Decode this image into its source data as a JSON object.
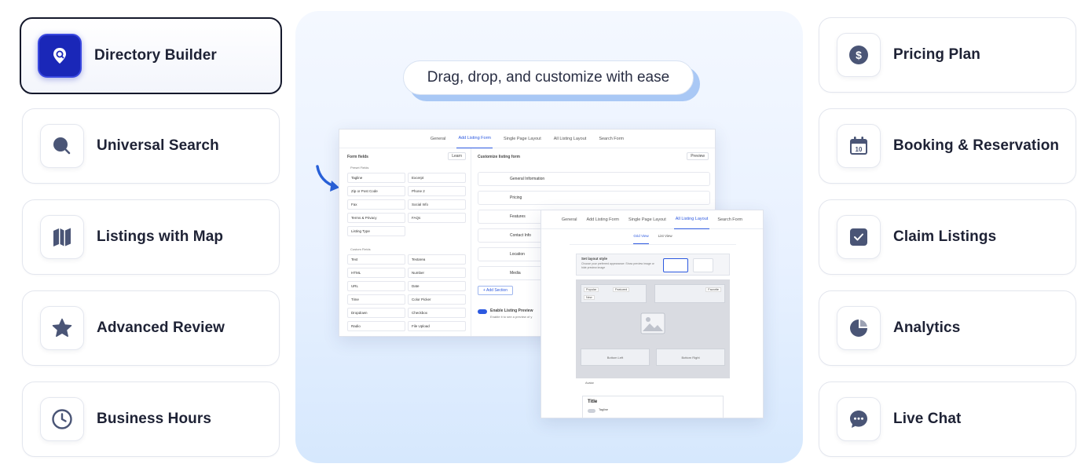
{
  "left_cards": [
    {
      "label": "Directory Builder",
      "icon": "directory-pin-icon",
      "active": true
    },
    {
      "label": "Universal Search",
      "icon": "search-icon",
      "active": false
    },
    {
      "label": "Listings with Map",
      "icon": "map-icon",
      "active": false
    },
    {
      "label": "Advanced Review",
      "icon": "star-icon",
      "active": false
    },
    {
      "label": "Business Hours",
      "icon": "clock-icon",
      "active": false
    }
  ],
  "right_cards": [
    {
      "label": "Pricing Plan",
      "icon": "dollar-icon"
    },
    {
      "label": "Booking & Reservation",
      "icon": "calendar-icon"
    },
    {
      "label": "Claim Listings",
      "icon": "checkbox-icon"
    },
    {
      "label": "Analytics",
      "icon": "pie-chart-icon"
    },
    {
      "label": "Live Chat",
      "icon": "chat-bubble-icon"
    }
  ],
  "hero": {
    "tagline": "Drag, drop, and customize with ease",
    "screenshot1": {
      "tabs": [
        "General",
        "Add Listing Form",
        "Single Page Layout",
        "All Listing Layout",
        "Search Form"
      ],
      "active_tab": "Add Listing Form",
      "form_fields_title": "Form fields",
      "learn_label": "Learn",
      "customize_title": "Customize listing form",
      "preview_label": "Preview",
      "preset_title": "Preset Fields",
      "preset_fields": [
        "Tagline",
        "Excerpt",
        "Zip or Post Code",
        "Phone 2",
        "Fax",
        "Social Info",
        "Terms & Privacy",
        "FAQs",
        "Listing Type"
      ],
      "custom_title": "Custom Fields",
      "custom_fields": [
        "Text",
        "Textarea",
        "HTML",
        "Number",
        "URL",
        "Date",
        "Time",
        "Color Picker",
        "Dropdown",
        "Checkbox",
        "Radio",
        "File Upload"
      ],
      "sections": [
        "General Information",
        "Pricing",
        "Features",
        "Contact Info",
        "Location",
        "Media"
      ],
      "add_section_label": "+ Add Section",
      "enable_preview_label": "Enable Listing Preview",
      "enable_preview_desc": "Enable it to see a preview of y"
    },
    "screenshot2": {
      "tabs": [
        "General",
        "Add Listing Form",
        "Single Page Layout",
        "All Listing Layout",
        "Search Form"
      ],
      "active_tab": "All Listing Layout",
      "view_tabs": [
        "Grid View",
        "List View"
      ],
      "layout_style_title": "Set layout style",
      "layout_style_desc": "Choose your preferred appearance: Show preview image or hide preview image",
      "tags": [
        "Popular",
        "Featured",
        "New"
      ],
      "favorite_label": "Favorite",
      "bottom_left_label": "Bottom Left",
      "bottom_right_label": "Bottom Right",
      "avatar_label": "Avatar",
      "title_label": "Title",
      "tagline_label": "Tagline"
    }
  },
  "colors": {
    "accent_blue": "#1a27b8",
    "icon_slate": "#4a5576",
    "text_dark": "#1e2235"
  }
}
